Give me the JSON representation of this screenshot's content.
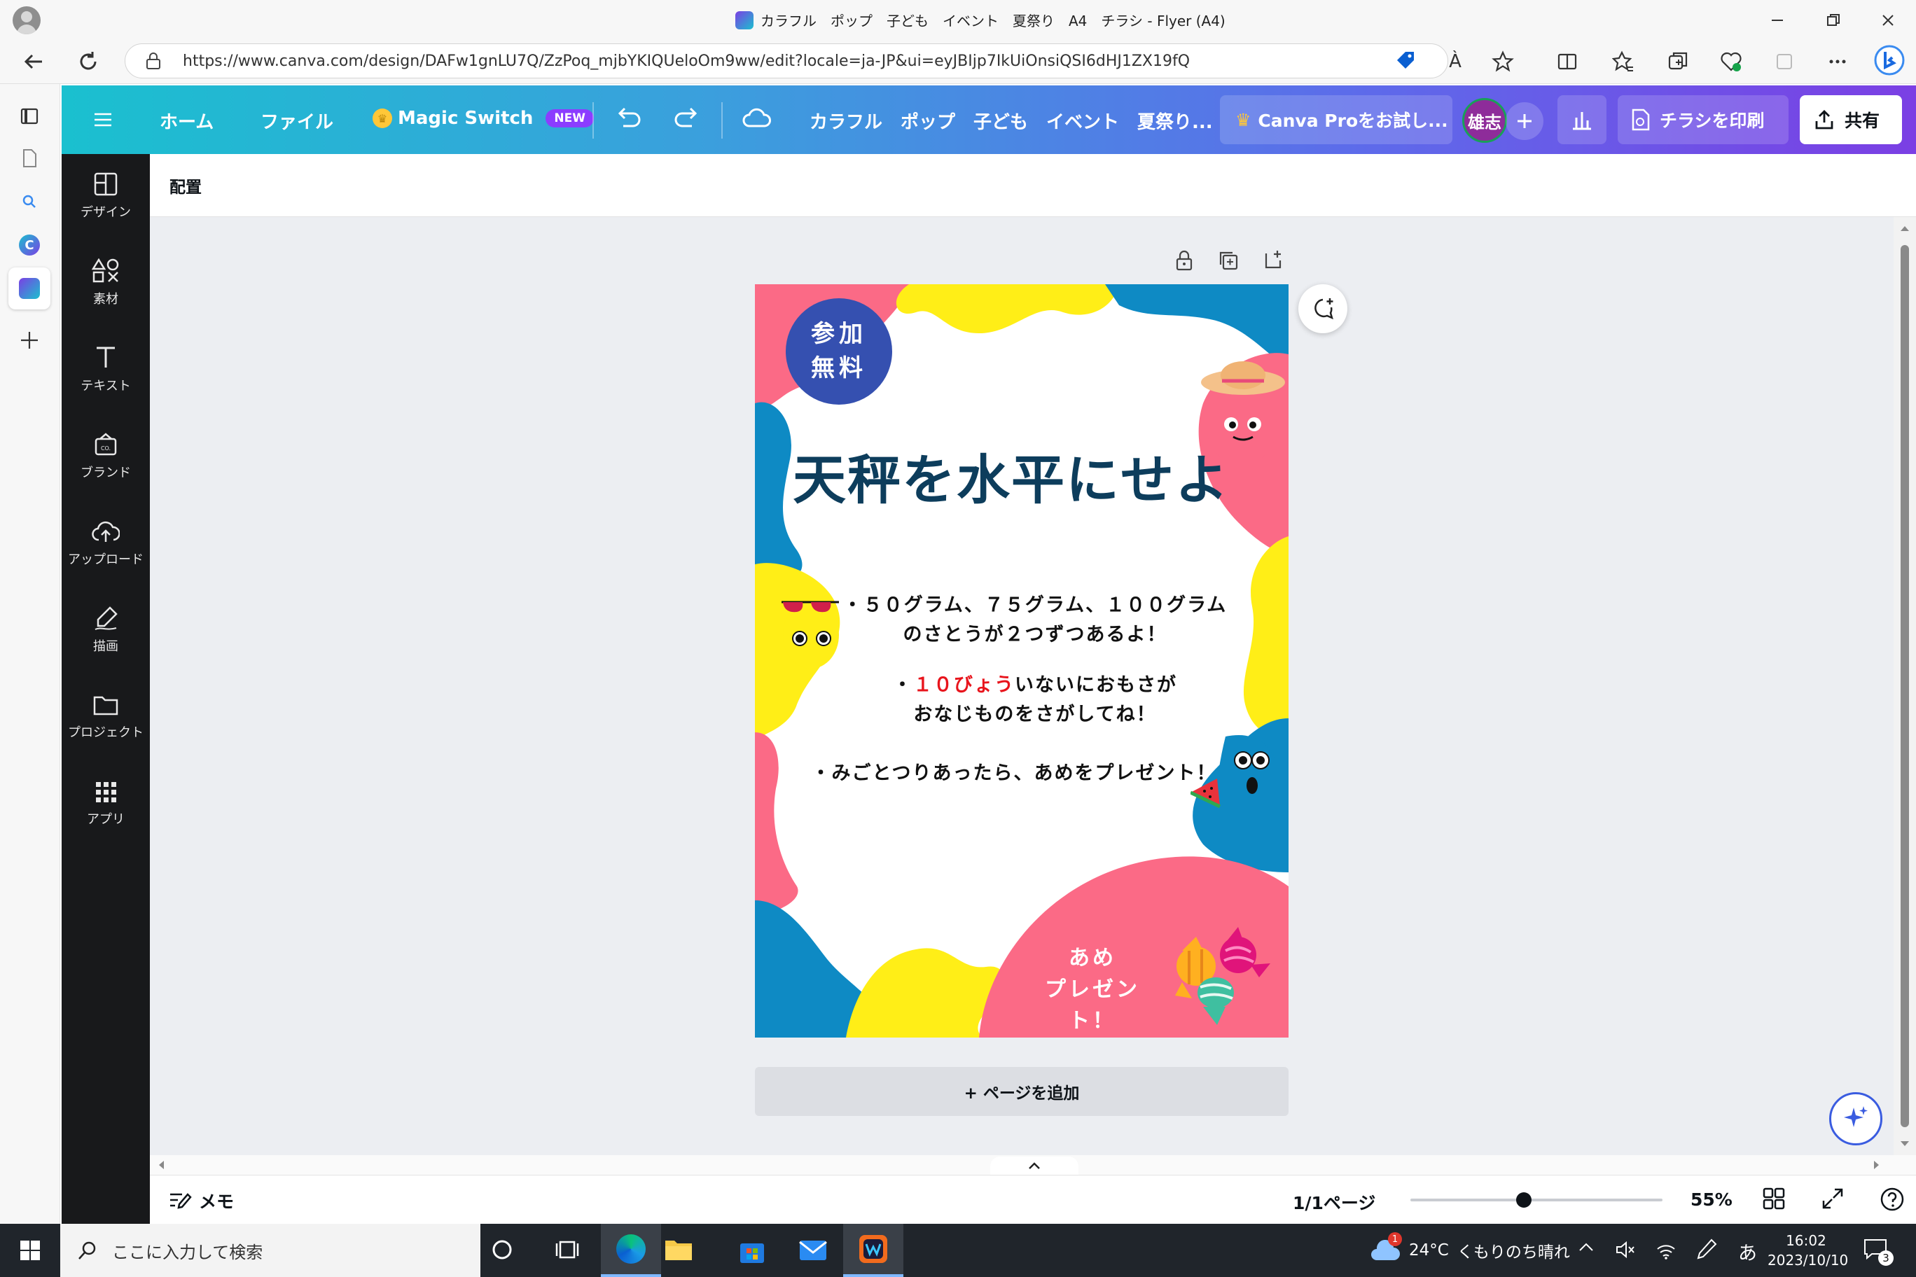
{
  "browser": {
    "window_title": "カラフル　ポップ　子ども　イベント　夏祭り　A4　チラシ - Flyer (A4)",
    "url": "https://www.canva.com/design/DAFw1gnLU7Q/ZzPoq_mjbYKIQUeloOm9ww/edit?locale=ja-JP&ui=eyJBIjp7IkUiOnsiQSI6dHJ1ZX19fQ",
    "read_aloud_label": "À"
  },
  "canva_header": {
    "home_label": "ホーム",
    "file_label": "ファイル",
    "magic_switch_label": "Magic Switch",
    "new_badge": "NEW",
    "design_title": "カラフル　ポップ　子ども　イベント　夏祭り...",
    "try_pro_label": "Canva Proをお試し...",
    "avatar_text": "雄志",
    "print_label": "チラシを印刷",
    "share_label": "共有"
  },
  "rail": {
    "items": [
      {
        "label": "デザイン"
      },
      {
        "label": "素材"
      },
      {
        "label": "テキスト"
      },
      {
        "label": "ブランド"
      },
      {
        "label": "アップロード"
      },
      {
        "label": "描画"
      },
      {
        "label": "プロジェクト"
      },
      {
        "label": "アプリ"
      }
    ]
  },
  "context_bar": {
    "position_label": "配置"
  },
  "flyer": {
    "badge_line1": "参加",
    "badge_line2": "無料",
    "title": "天秤を水平にせよ",
    "bullet1_line1": "・５０グラム、７５グラム、１００グラム",
    "bullet1_line2": "のさとうが２つずつあるよ！",
    "bullet2_prefix": "・",
    "bullet2_highlight": "１０びょう",
    "bullet2_rest": "いないにおもさが",
    "bullet2_line2": "おなじものをさがしてね！",
    "bullet3": "・みごとつりあったら、あめをプレゼント！",
    "prize_line1": "あめ",
    "prize_line2": "プレゼント！",
    "colors": {
      "pink": "#fb6a86",
      "yellow": "#ffee17",
      "blue": "#0e8ac4",
      "navy": "#3550b0",
      "title": "#0d3d5c",
      "red": "#e8141c"
    }
  },
  "canvas": {
    "add_page_label": "+ ページを追加"
  },
  "footer": {
    "memo_label": "メモ",
    "page_indicator": "1/1ページ",
    "zoom_value": "55%",
    "zoom_fraction": 0.45
  },
  "taskbar": {
    "search_placeholder": "ここに入力して検索",
    "weather_temp": "24°C",
    "weather_desc": "くもりのち晴れ",
    "ime": "あ",
    "time": "16:02",
    "date": "2023/10/10",
    "notification_count": "3",
    "weather_alert": "1"
  }
}
